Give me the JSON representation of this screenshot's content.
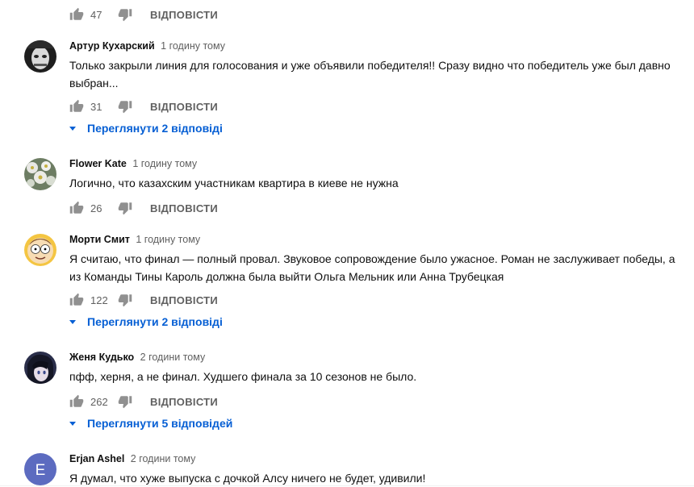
{
  "reply_label": "ВІДПОВІСТИ",
  "top_row": {
    "likes": "47"
  },
  "comments": [
    {
      "author": "Артур Кухарский",
      "time": "1 годину тому",
      "text": "Только закрыли линия для голосования и уже объявили победителя!! Сразу видно что победитель уже был давно выбран...",
      "likes": "31",
      "replies": "Переглянути 2 відповіді",
      "avatar": "dark-face-avatar"
    },
    {
      "author": "Flower Kate",
      "time": "1 годину тому",
      "text": "Логично, что казахским участникам квартира в киеве не нужна",
      "likes": "26",
      "avatar": "flower-avatar"
    },
    {
      "author": "Морти Смит",
      "time": "1 годину тому",
      "text": "Я считаю, что финал — полный провал. Звуковое сопровождение было ужасное. Роман не заслуживает победы, а из Команды Тины Кароль должна была выйти Ольга Мельник или Анна Трубецкая",
      "likes": "122",
      "replies": "Переглянути 2 відповіді",
      "avatar": "cartoon-face-avatar"
    },
    {
      "author": "Женя Кудько",
      "time": "2 години тому",
      "text": "пфф, херня, а не финал. Худшего финала за 10 сезонов не было.",
      "likes": "262",
      "replies": "Переглянути 5 відповідей",
      "avatar": "anime-avatar"
    },
    {
      "author": "Erjan Ashel",
      "time": "2 години тому",
      "text": "Я думал, что хуже выпуска с дочкой Алсу ничего не будет, удивили!",
      "avatar_letter": "E",
      "avatar_color": "#5c6bc0",
      "avatar": "letter-avatar"
    }
  ],
  "colors": {
    "link_blue": "#065fd4",
    "meta_gray": "#606060",
    "icon_gray": "#909090"
  }
}
